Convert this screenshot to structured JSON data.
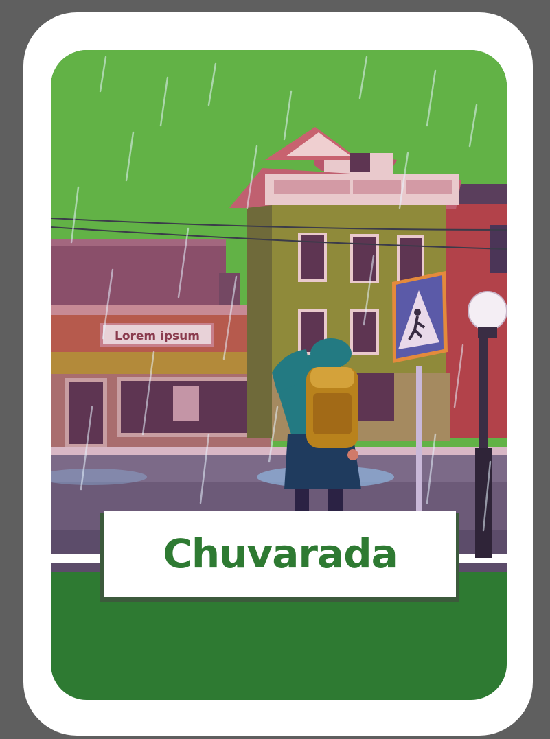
{
  "card": {
    "title": "Chuvarada",
    "illustration_subject": "rainy-street-scene",
    "shop_sign_text": "Lorem ipsum"
  },
  "colors": {
    "frame": "#5f5f5f",
    "card": "#ffffff",
    "sky": "#62b246",
    "bottom_band": "#2e7a32",
    "title_text": "#2e7a32"
  }
}
